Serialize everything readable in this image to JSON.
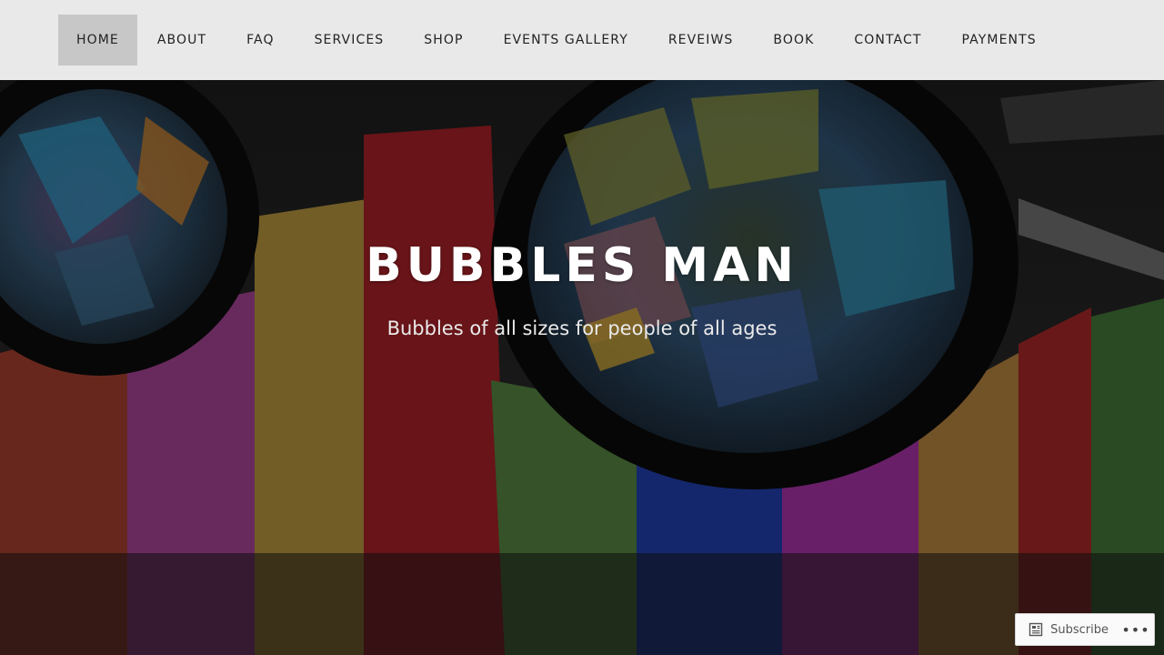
{
  "nav": {
    "items": [
      {
        "label": "HOME",
        "active": true
      },
      {
        "label": "ABOUT",
        "active": false
      },
      {
        "label": "FAQ",
        "active": false
      },
      {
        "label": "SERVICES",
        "active": false
      },
      {
        "label": "SHOP",
        "active": false
      },
      {
        "label": "EVENTS GALLERY",
        "active": false
      },
      {
        "label": "REVEIWS",
        "active": false
      },
      {
        "label": "BOOK",
        "active": false
      },
      {
        "label": "CONTACT",
        "active": false
      },
      {
        "label": "PAYMENTS",
        "active": false
      }
    ]
  },
  "hero": {
    "title": "BUBBLES MAN",
    "tagline": "Bubbles of all sizes for people of all ages",
    "image_icon": "rainbow-hat-goggles-photo"
  },
  "subscribe": {
    "label": "Subscribe",
    "icon": "reader-icon",
    "more_label": "•••"
  },
  "colors": {
    "nav_background": "#e9e9e9",
    "nav_active": "#c7c7c7",
    "title_text": "#ffffff"
  }
}
